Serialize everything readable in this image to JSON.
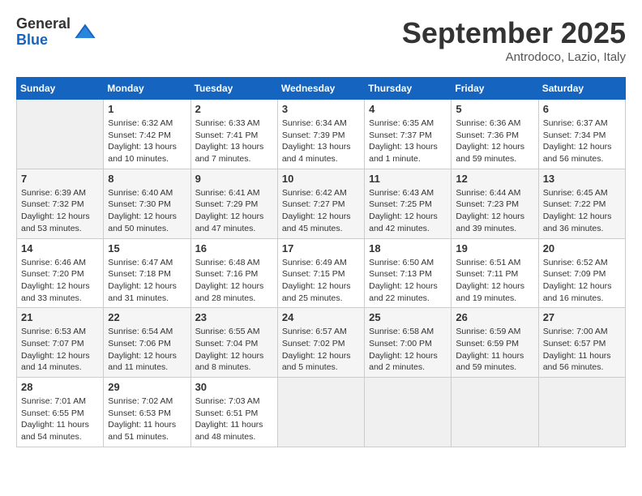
{
  "logo": {
    "general": "General",
    "blue": "Blue"
  },
  "header": {
    "month": "September 2025",
    "location": "Antrodoco, Lazio, Italy"
  },
  "weekdays": [
    "Sunday",
    "Monday",
    "Tuesday",
    "Wednesday",
    "Thursday",
    "Friday",
    "Saturday"
  ],
  "weeks": [
    [
      {
        "day": "",
        "sunrise": "",
        "sunset": "",
        "daylight": ""
      },
      {
        "day": "1",
        "sunrise": "Sunrise: 6:32 AM",
        "sunset": "Sunset: 7:42 PM",
        "daylight": "Daylight: 13 hours and 10 minutes."
      },
      {
        "day": "2",
        "sunrise": "Sunrise: 6:33 AM",
        "sunset": "Sunset: 7:41 PM",
        "daylight": "Daylight: 13 hours and 7 minutes."
      },
      {
        "day": "3",
        "sunrise": "Sunrise: 6:34 AM",
        "sunset": "Sunset: 7:39 PM",
        "daylight": "Daylight: 13 hours and 4 minutes."
      },
      {
        "day": "4",
        "sunrise": "Sunrise: 6:35 AM",
        "sunset": "Sunset: 7:37 PM",
        "daylight": "Daylight: 13 hours and 1 minute."
      },
      {
        "day": "5",
        "sunrise": "Sunrise: 6:36 AM",
        "sunset": "Sunset: 7:36 PM",
        "daylight": "Daylight: 12 hours and 59 minutes."
      },
      {
        "day": "6",
        "sunrise": "Sunrise: 6:37 AM",
        "sunset": "Sunset: 7:34 PM",
        "daylight": "Daylight: 12 hours and 56 minutes."
      }
    ],
    [
      {
        "day": "7",
        "sunrise": "Sunrise: 6:39 AM",
        "sunset": "Sunset: 7:32 PM",
        "daylight": "Daylight: 12 hours and 53 minutes."
      },
      {
        "day": "8",
        "sunrise": "Sunrise: 6:40 AM",
        "sunset": "Sunset: 7:30 PM",
        "daylight": "Daylight: 12 hours and 50 minutes."
      },
      {
        "day": "9",
        "sunrise": "Sunrise: 6:41 AM",
        "sunset": "Sunset: 7:29 PM",
        "daylight": "Daylight: 12 hours and 47 minutes."
      },
      {
        "day": "10",
        "sunrise": "Sunrise: 6:42 AM",
        "sunset": "Sunset: 7:27 PM",
        "daylight": "Daylight: 12 hours and 45 minutes."
      },
      {
        "day": "11",
        "sunrise": "Sunrise: 6:43 AM",
        "sunset": "Sunset: 7:25 PM",
        "daylight": "Daylight: 12 hours and 42 minutes."
      },
      {
        "day": "12",
        "sunrise": "Sunrise: 6:44 AM",
        "sunset": "Sunset: 7:23 PM",
        "daylight": "Daylight: 12 hours and 39 minutes."
      },
      {
        "day": "13",
        "sunrise": "Sunrise: 6:45 AM",
        "sunset": "Sunset: 7:22 PM",
        "daylight": "Daylight: 12 hours and 36 minutes."
      }
    ],
    [
      {
        "day": "14",
        "sunrise": "Sunrise: 6:46 AM",
        "sunset": "Sunset: 7:20 PM",
        "daylight": "Daylight: 12 hours and 33 minutes."
      },
      {
        "day": "15",
        "sunrise": "Sunrise: 6:47 AM",
        "sunset": "Sunset: 7:18 PM",
        "daylight": "Daylight: 12 hours and 31 minutes."
      },
      {
        "day": "16",
        "sunrise": "Sunrise: 6:48 AM",
        "sunset": "Sunset: 7:16 PM",
        "daylight": "Daylight: 12 hours and 28 minutes."
      },
      {
        "day": "17",
        "sunrise": "Sunrise: 6:49 AM",
        "sunset": "Sunset: 7:15 PM",
        "daylight": "Daylight: 12 hours and 25 minutes."
      },
      {
        "day": "18",
        "sunrise": "Sunrise: 6:50 AM",
        "sunset": "Sunset: 7:13 PM",
        "daylight": "Daylight: 12 hours and 22 minutes."
      },
      {
        "day": "19",
        "sunrise": "Sunrise: 6:51 AM",
        "sunset": "Sunset: 7:11 PM",
        "daylight": "Daylight: 12 hours and 19 minutes."
      },
      {
        "day": "20",
        "sunrise": "Sunrise: 6:52 AM",
        "sunset": "Sunset: 7:09 PM",
        "daylight": "Daylight: 12 hours and 16 minutes."
      }
    ],
    [
      {
        "day": "21",
        "sunrise": "Sunrise: 6:53 AM",
        "sunset": "Sunset: 7:07 PM",
        "daylight": "Daylight: 12 hours and 14 minutes."
      },
      {
        "day": "22",
        "sunrise": "Sunrise: 6:54 AM",
        "sunset": "Sunset: 7:06 PM",
        "daylight": "Daylight: 12 hours and 11 minutes."
      },
      {
        "day": "23",
        "sunrise": "Sunrise: 6:55 AM",
        "sunset": "Sunset: 7:04 PM",
        "daylight": "Daylight: 12 hours and 8 minutes."
      },
      {
        "day": "24",
        "sunrise": "Sunrise: 6:57 AM",
        "sunset": "Sunset: 7:02 PM",
        "daylight": "Daylight: 12 hours and 5 minutes."
      },
      {
        "day": "25",
        "sunrise": "Sunrise: 6:58 AM",
        "sunset": "Sunset: 7:00 PM",
        "daylight": "Daylight: 12 hours and 2 minutes."
      },
      {
        "day": "26",
        "sunrise": "Sunrise: 6:59 AM",
        "sunset": "Sunset: 6:59 PM",
        "daylight": "Daylight: 11 hours and 59 minutes."
      },
      {
        "day": "27",
        "sunrise": "Sunrise: 7:00 AM",
        "sunset": "Sunset: 6:57 PM",
        "daylight": "Daylight: 11 hours and 56 minutes."
      }
    ],
    [
      {
        "day": "28",
        "sunrise": "Sunrise: 7:01 AM",
        "sunset": "Sunset: 6:55 PM",
        "daylight": "Daylight: 11 hours and 54 minutes."
      },
      {
        "day": "29",
        "sunrise": "Sunrise: 7:02 AM",
        "sunset": "Sunset: 6:53 PM",
        "daylight": "Daylight: 11 hours and 51 minutes."
      },
      {
        "day": "30",
        "sunrise": "Sunrise: 7:03 AM",
        "sunset": "Sunset: 6:51 PM",
        "daylight": "Daylight: 11 hours and 48 minutes."
      },
      {
        "day": "",
        "sunrise": "",
        "sunset": "",
        "daylight": ""
      },
      {
        "day": "",
        "sunrise": "",
        "sunset": "",
        "daylight": ""
      },
      {
        "day": "",
        "sunrise": "",
        "sunset": "",
        "daylight": ""
      },
      {
        "day": "",
        "sunrise": "",
        "sunset": "",
        "daylight": ""
      }
    ]
  ]
}
